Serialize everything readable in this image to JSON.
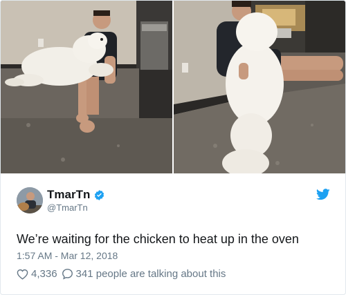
{
  "tweet": {
    "display_name": "TmarTn",
    "handle": "@TmarTn",
    "text": "We’re waiting for the chicken to heat up in the oven",
    "timestamp": "1:57 AM - Mar 12, 2018",
    "likes": "4,336",
    "talking": "341 people are talking about this"
  },
  "icons": {
    "verified": "verified-badge-icon",
    "brand": "twitter-bird-icon",
    "like": "heart-icon",
    "reply": "speech-bubble-icon"
  },
  "colors": {
    "brand_blue": "#1da1f2",
    "text": "#14171a",
    "muted": "#657786",
    "border": "#e1e8ed"
  }
}
